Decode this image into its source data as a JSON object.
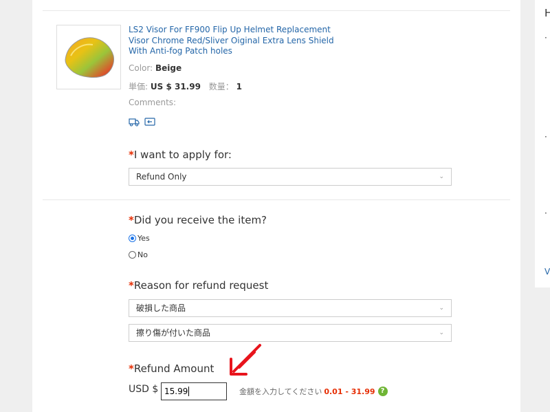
{
  "product": {
    "title": "LS2 Visor For FF900 Flip Up Helmet Replacement Visor Chrome Red/Sliver Oiginal Extra Lens Shield With Anti-fog Patch holes",
    "color_label": "Color:",
    "color_value": "Beige",
    "unit_price_label": "単価:",
    "unit_price_value": "US $ 31.99",
    "quantity_label": "数量：",
    "quantity_value": "1",
    "comments_label": "Comments:",
    "icons": [
      "shipping-icon",
      "return-icon"
    ]
  },
  "apply_for": {
    "required_mark": "*",
    "label": "I want to apply for:",
    "selected": "Refund Only"
  },
  "received": {
    "required_mark": "*",
    "label": "Did you receive the item?",
    "options": [
      "Yes",
      "No"
    ],
    "selected_index": 0
  },
  "reason": {
    "required_mark": "*",
    "label": "Reason for refund request",
    "selected_primary": "破損した商品",
    "selected_secondary": "擦り傷が付いた商品"
  },
  "refund_amount": {
    "required_mark": "*",
    "label": "Refund Amount",
    "currency": "USD $",
    "value": "15.99",
    "hint": "金額を入力してください",
    "range": "0.01 - 31.99",
    "help_glyph": "?"
  },
  "side_panel": {
    "heading": "H",
    "bullet": "·",
    "link": "V"
  },
  "colors": {
    "link": "#2466a8",
    "required": "#e62e04",
    "arrow": "#e8141c",
    "help": "#6fb535",
    "radio": "#1a73e8"
  }
}
